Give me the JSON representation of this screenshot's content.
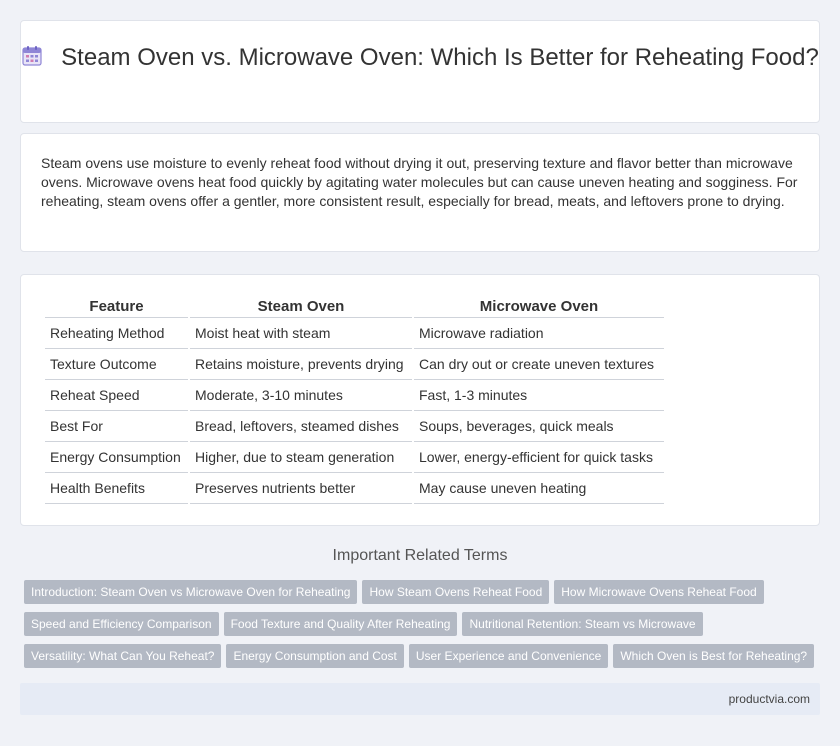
{
  "header": {
    "icon": "calendar-icon",
    "title": "Steam Oven vs. Microwave Oven: Which Is Better for Reheating Food?"
  },
  "intro": {
    "text": "Steam ovens use moisture to evenly reheat food without drying it out, preserving texture and flavor better than microwave ovens. Microwave ovens heat food quickly by agitating water molecules but can cause uneven heating and sogginess. For reheating, steam ovens offer a gentler, more consistent result, especially for bread, meats, and leftovers prone to drying."
  },
  "table": {
    "headers": [
      "Feature",
      "Steam Oven",
      "Microwave Oven"
    ],
    "rows": [
      [
        "Reheating Method",
        "Moist heat with steam",
        "Microwave radiation"
      ],
      [
        "Texture Outcome",
        "Retains moisture, prevents drying",
        "Can dry out or create uneven textures"
      ],
      [
        "Reheat Speed",
        "Moderate, 3-10 minutes",
        "Fast, 1-3 minutes"
      ],
      [
        "Best For",
        "Bread, leftovers, steamed dishes",
        "Soups, beverages, quick meals"
      ],
      [
        "Energy Consumption",
        "Higher, due to steam generation",
        "Lower, energy-efficient for quick tasks"
      ],
      [
        "Health Benefits",
        "Preserves nutrients better",
        "May cause uneven heating"
      ]
    ]
  },
  "related": {
    "title": "Important Related Terms",
    "rows": [
      [
        "Introduction: Steam Oven vs Microwave Oven for Reheating",
        "How Steam Ovens Reheat Food",
        "How Microwave Ovens Reheat Food"
      ],
      [
        "Speed and Efficiency Comparison",
        "Food Texture and Quality After Reheating",
        "Nutritional Retention: Steam vs Microwave"
      ],
      [
        "Versatility: What Can You Reheat?",
        "Energy Consumption and Cost",
        "User Experience and Convenience",
        "Which Oven is Best for Reheating?"
      ]
    ]
  },
  "footer": {
    "text": "productvia.com"
  }
}
